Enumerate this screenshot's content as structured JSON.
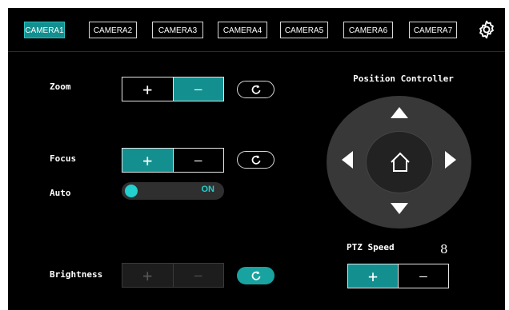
{
  "tabs": [
    {
      "label": "CAMERA1",
      "active": true
    },
    {
      "label": "CAMERA2",
      "active": false
    },
    {
      "label": "CAMERA3",
      "active": false
    },
    {
      "label": "CAMERA4",
      "active": false
    },
    {
      "label": "CAMERA5",
      "active": false
    },
    {
      "label": "CAMERA6",
      "active": false
    },
    {
      "label": "CAMERA7",
      "active": false
    }
  ],
  "settings": {
    "icon": "gear-icon"
  },
  "controls": {
    "zoom": {
      "label": "Zoom",
      "plus": "+",
      "minus": "—",
      "active": "minus",
      "reset_icon": "reset-icon"
    },
    "focus": {
      "label": "Focus",
      "plus": "+",
      "minus": "—",
      "active": "plus",
      "reset_icon": "reset-icon"
    },
    "auto": {
      "label": "Auto",
      "state": "ON"
    },
    "brightness": {
      "label": "Brightness",
      "plus": "+",
      "minus": "—",
      "disabled": true,
      "reset_icon": "reset-icon"
    }
  },
  "position": {
    "title": "Position Controller",
    "home_icon": "home-icon"
  },
  "ptz_speed": {
    "label": "PTZ Speed",
    "value": "8",
    "plus": "+",
    "minus": "—",
    "active": "plus"
  },
  "colors": {
    "accent": "#138f8f",
    "toggle": "#22d0d0",
    "background": "#000000"
  }
}
